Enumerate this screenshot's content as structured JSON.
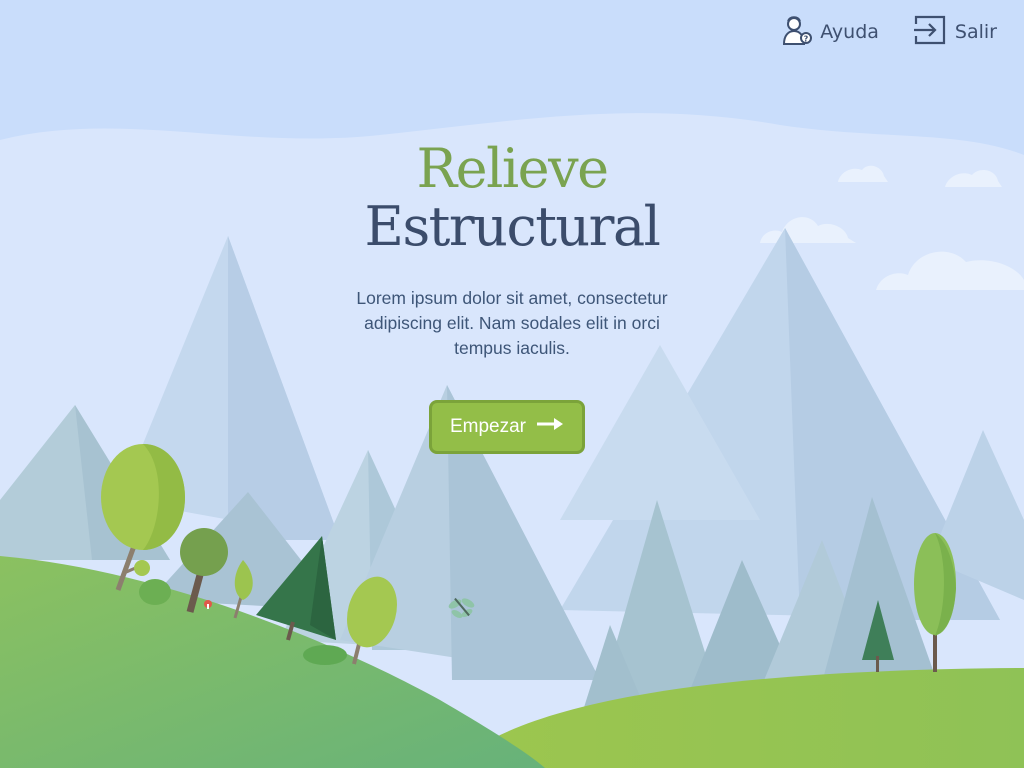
{
  "header": {
    "help_label": "Ayuda",
    "exit_label": "Salir"
  },
  "hero": {
    "title_line1": "Relieve",
    "title_line2": "Estructural",
    "subtitle": "Lorem ipsum dolor sit amet, consectetur adipiscing elit. Nam sodales elit in orci tempus iaculis.",
    "start_label": "Empezar"
  },
  "icons": {
    "help": "help-person-icon",
    "exit": "exit-door-icon",
    "start": "arrow-right-icon"
  },
  "colors": {
    "sky": "#c9ddfb",
    "title_green": "#7aa350",
    "title_navy": "#3b4c6b",
    "button": "#93be48",
    "grass": "#6fb86e"
  }
}
